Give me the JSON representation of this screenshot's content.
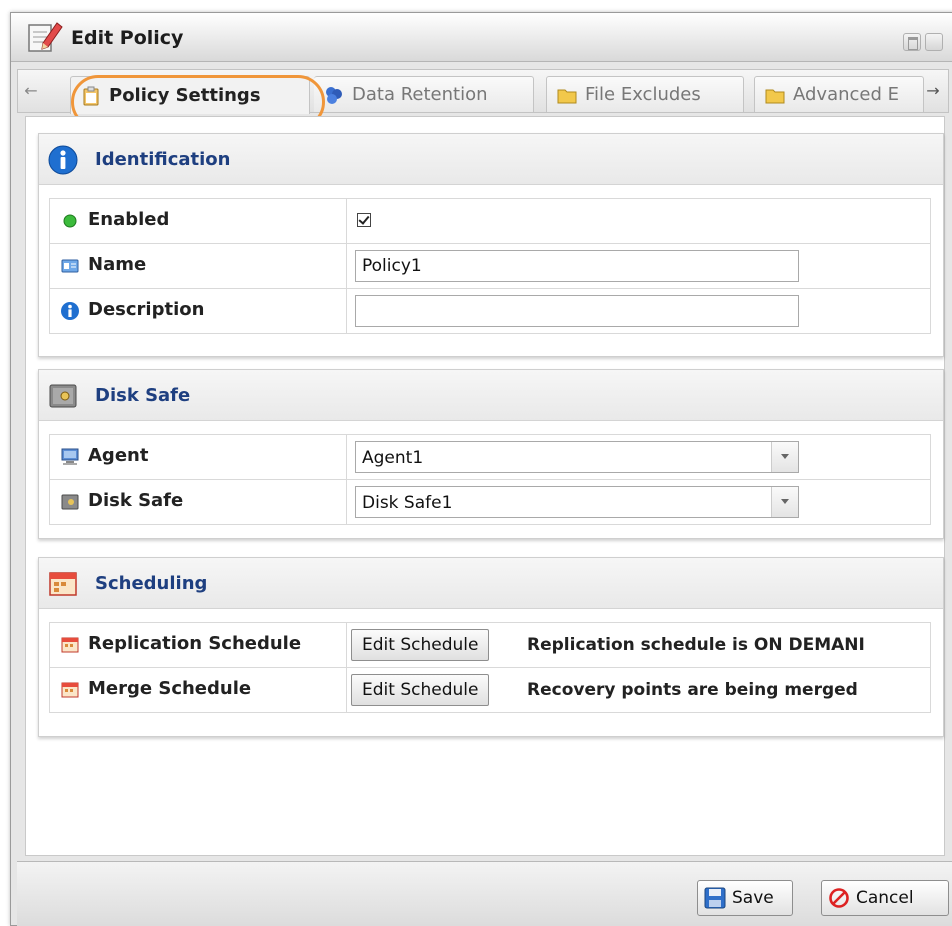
{
  "window": {
    "title": "Edit Policy",
    "title_icon": "edit-document-icon"
  },
  "tabs": [
    {
      "label": "Policy Settings",
      "icon": "policy-clipboard-icon",
      "active": true
    },
    {
      "label": "Data Retention",
      "icon": "data-retention-icon",
      "active": false
    },
    {
      "label": "File Excludes",
      "icon": "folder-icon",
      "active": false
    },
    {
      "label": "Advanced E",
      "icon": "folder-icon",
      "active": false
    }
  ],
  "identification": {
    "title": "Identification",
    "enabled_label": "Enabled",
    "enabled_checked": true,
    "name_label": "Name",
    "name_value": "Policy1",
    "description_label": "Description",
    "description_value": ""
  },
  "disk_safe_section": {
    "title": "Disk Safe",
    "agent_label": "Agent",
    "agent_value": "Agent1",
    "disk_safe_label": "Disk Safe",
    "disk_safe_value": "Disk Safe1"
  },
  "scheduling": {
    "title": "Scheduling",
    "replication_label": "Replication Schedule",
    "replication_button": "Edit Schedule",
    "replication_text": "Replication schedule is ON DEMANI",
    "merge_label": "Merge Schedule",
    "merge_button": "Edit Schedule",
    "merge_text": "Recovery points are being merged"
  },
  "footer": {
    "save_label": "Save",
    "cancel_label": "Cancel"
  },
  "colors": {
    "section_title": "#1e3f80",
    "highlight_ring": "#f0963a"
  }
}
